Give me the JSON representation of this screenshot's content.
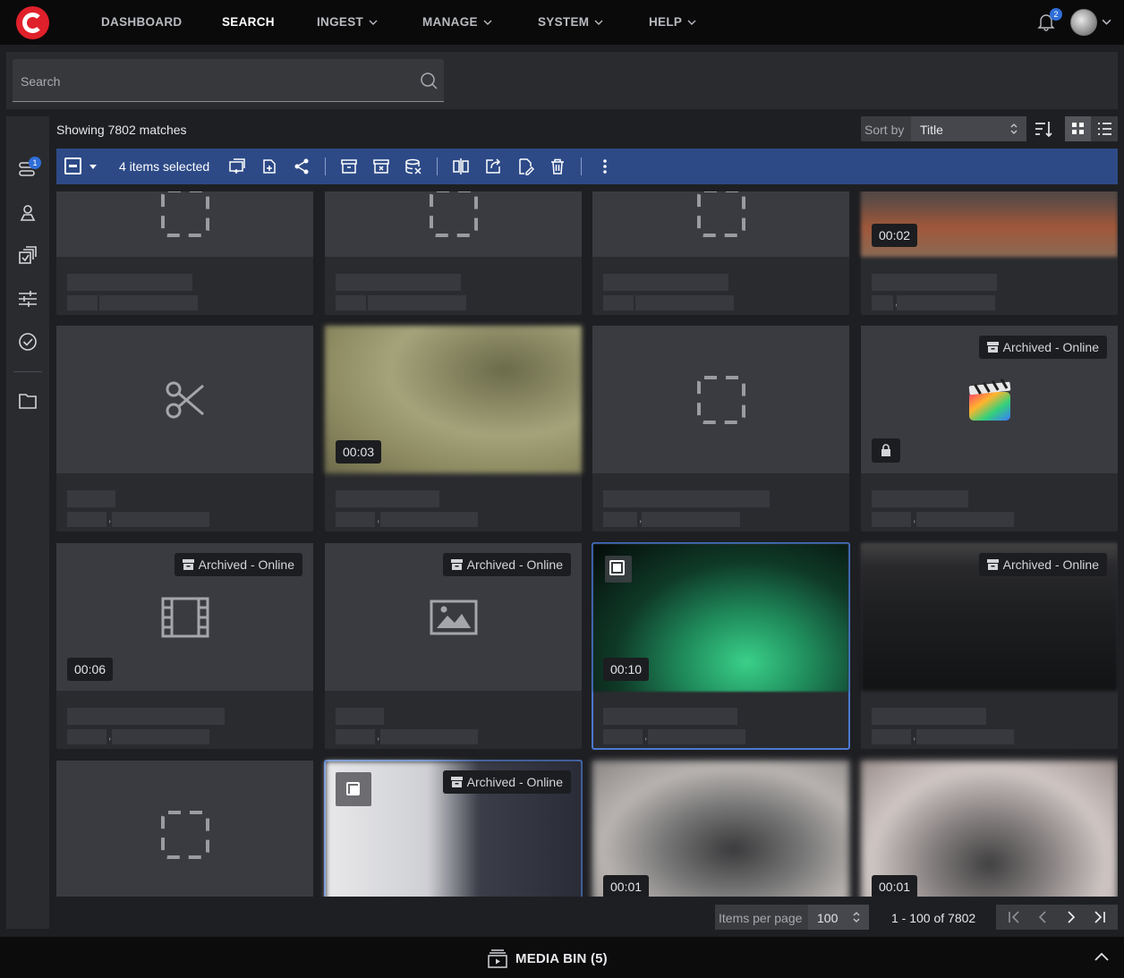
{
  "nav": {
    "items": [
      {
        "label": "DASHBOARD",
        "dropdown": false,
        "active": false
      },
      {
        "label": "SEARCH",
        "dropdown": false,
        "active": true
      },
      {
        "label": "INGEST",
        "dropdown": true,
        "active": false
      },
      {
        "label": "MANAGE",
        "dropdown": true,
        "active": false
      },
      {
        "label": "SYSTEM",
        "dropdown": true,
        "active": false
      },
      {
        "label": "HELP",
        "dropdown": true,
        "active": false
      }
    ],
    "notification_count": "2"
  },
  "search": {
    "placeholder": "Search"
  },
  "rail": {
    "queue_badge": "1"
  },
  "results": {
    "summary": "Showing 7802 matches",
    "sort_label": "Sort by",
    "sort_value": "Title",
    "view_mode": "grid"
  },
  "selection": {
    "label": "4 items selected"
  },
  "cards": [
    {
      "thumb": "placeholder",
      "duration": "",
      "archived": ""
    },
    {
      "thumb": "placeholder",
      "duration": "",
      "archived": ""
    },
    {
      "thumb": "placeholder",
      "duration": "",
      "archived": ""
    },
    {
      "thumb": "blur-orange",
      "duration": "00:02",
      "archived": ""
    },
    {
      "thumb": "scissors-icon",
      "duration": "",
      "archived": ""
    },
    {
      "thumb": "blur-olive",
      "duration": "00:03",
      "archived": ""
    },
    {
      "thumb": "placeholder",
      "duration": "",
      "archived": ""
    },
    {
      "thumb": "finalcut-icon",
      "duration": "",
      "archived": "Archived - Online",
      "locked": true
    },
    {
      "thumb": "film-icon",
      "duration": "00:06",
      "archived": "Archived - Online"
    },
    {
      "thumb": "image-icon",
      "duration": "",
      "archived": "Archived - Online"
    },
    {
      "thumb": "blur-green",
      "duration": "00:10",
      "archived": "",
      "selected": true
    },
    {
      "thumb": "blur-dark",
      "duration": "",
      "archived": "Archived - Online"
    },
    {
      "thumb": "placeholder",
      "duration": "",
      "archived": ""
    },
    {
      "thumb": "blur-screen",
      "duration": "",
      "archived": "Archived - Online",
      "selected": true
    },
    {
      "thumb": "blur-grey",
      "duration": "00:01",
      "archived": ""
    },
    {
      "thumb": "blur-grey2",
      "duration": "00:01",
      "archived": ""
    }
  ],
  "pagination": {
    "items_per_page_label": "Items per page",
    "items_per_page": "100",
    "range": "1 - 100 of 7802"
  },
  "media_bin": {
    "label": "MEDIA BIN (5)"
  },
  "colors": {
    "accent": "#2d4a87",
    "selection_outline": "#4b78d0",
    "logo": "#e0202a",
    "badge": "#2f6ed8"
  }
}
